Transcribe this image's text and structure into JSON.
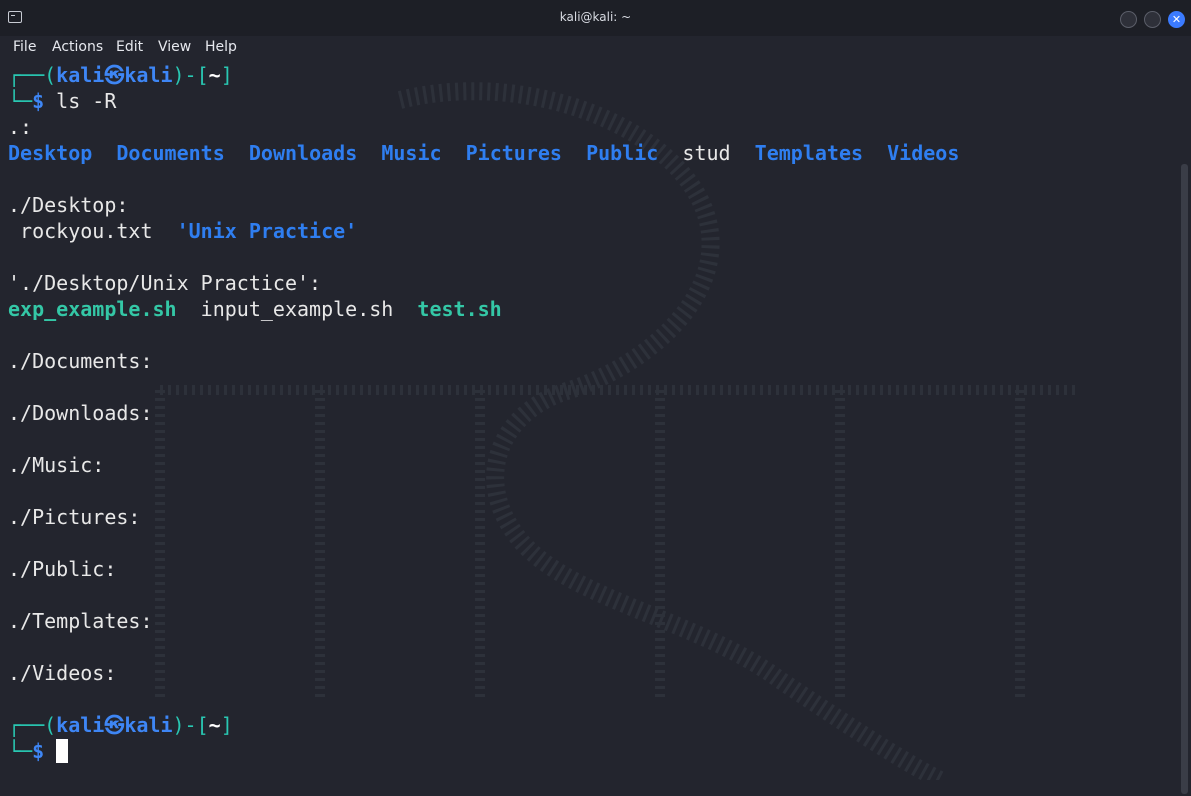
{
  "window": {
    "title": "kali@kali: ~"
  },
  "menu": [
    "File",
    "Actions",
    "Edit",
    "View",
    "Help"
  ],
  "prompt": {
    "user": "kali",
    "at": "㉿",
    "host": "kali",
    "path": "~",
    "frame_top_left": "┌──(",
    "frame_mid": ")-[",
    "frame_end": "]",
    "frame_bottom": "└─",
    "symbol": "$"
  },
  "command": " ls -R",
  "output": {
    "root_header": ".:",
    "root_items": [
      {
        "name": "Desktop",
        "kind": "dir"
      },
      {
        "name": "Documents",
        "kind": "dir"
      },
      {
        "name": "Downloads",
        "kind": "dir"
      },
      {
        "name": "Music",
        "kind": "dir"
      },
      {
        "name": "Pictures",
        "kind": "dir"
      },
      {
        "name": "Public",
        "kind": "dir"
      },
      {
        "name": "stud",
        "kind": "file"
      },
      {
        "name": "Templates",
        "kind": "dir"
      },
      {
        "name": "Videos",
        "kind": "dir"
      }
    ],
    "desktop_header": "./Desktop:",
    "desktop_file": "rockyou.txt",
    "desktop_dir": "'Unix Practice'",
    "unix_header": "'./Desktop/Unix Practice':",
    "unix_exec1": "exp_example.sh",
    "unix_file": "input_example.sh",
    "unix_exec2": "test.sh",
    "empty_headers": [
      "./Documents:",
      "./Downloads:",
      "./Music:",
      "./Pictures:",
      "./Public:",
      "./Templates:",
      "./Videos:"
    ]
  },
  "colors": {
    "background": "#23252e",
    "directory": "#2f7ef0",
    "executable": "#34c7a6",
    "prompt_frame": "#29c7b2",
    "prompt_user": "#3e86f5"
  },
  "icons": {
    "terminal": "terminal-icon",
    "minimize": "minimize-icon",
    "maximize": "maximize-icon",
    "close": "close-icon"
  }
}
